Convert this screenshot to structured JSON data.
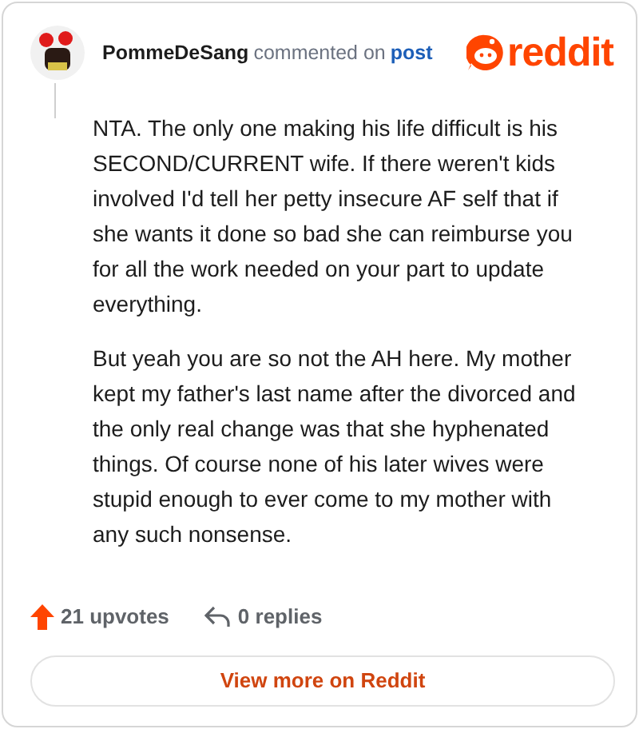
{
  "comment": {
    "author": "PommeDeSang",
    "action": "commented on",
    "link": "post",
    "paragraphs": [
      "NTA. The only one making his life difficult is his SECOND/CURRENT wife. If there weren't kids involved I'd tell her petty insecure AF self that if she wants it done so bad she can reimburse you for all the work needed on your part to update everything.",
      "But yeah you are so not the AH here. My mother kept my father's last name after the divorced and the only real change was that she hyphenated things. Of course none of his later wives were stupid enough to ever come to my mother with any such nonsense."
    ]
  },
  "logo": {
    "text": "reddit"
  },
  "stats": {
    "upvotes": "21 upvotes",
    "replies": "0 replies"
  },
  "button": {
    "label": "View more on Reddit"
  }
}
